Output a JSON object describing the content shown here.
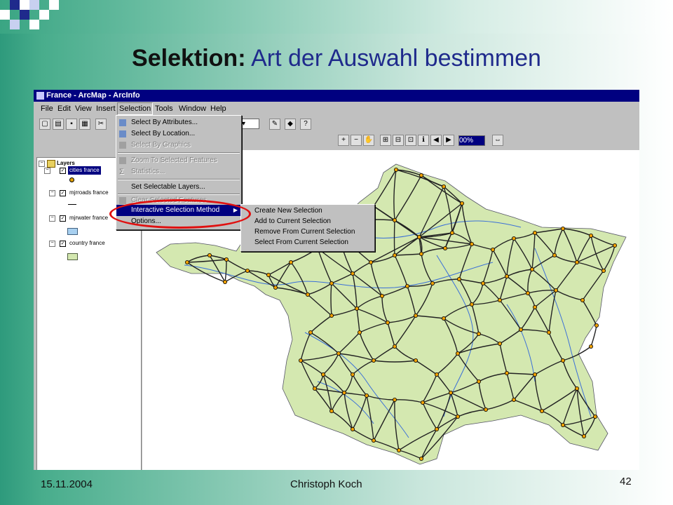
{
  "slide": {
    "title_bold": "Selektion:",
    "title_rest": "Art der Auswahl bestimmen",
    "footer_date": "15.11.2004",
    "footer_author": "Christoph Koch",
    "footer_page": "42"
  },
  "window": {
    "title": "France - ArcMap - ArcInfo",
    "menubar": [
      "File",
      "Edit",
      "View",
      "Insert",
      "Selection",
      "Tools",
      "Window",
      "Help"
    ],
    "active_menu": "Selection",
    "zoom_value": "00%"
  },
  "toc": {
    "root": "Layers",
    "layers": [
      {
        "name": "cities france",
        "selected": true,
        "symbol": "point"
      },
      {
        "name": "mjrroads france",
        "selected": false,
        "symbol": "line"
      },
      {
        "name": "mjrwater france",
        "selected": false,
        "symbol": "fill-blue"
      },
      {
        "name": "country france",
        "selected": false,
        "symbol": "fill-green"
      }
    ]
  },
  "selection_menu": {
    "items": [
      {
        "label": "Select By Attributes...",
        "disabled": false,
        "icon": "select-attributes-icon"
      },
      {
        "label": "Select By Location...",
        "disabled": false,
        "icon": "select-location-icon"
      },
      {
        "label": "Select By Graphics",
        "disabled": true,
        "icon": "select-graphics-icon"
      },
      {
        "label": "Zoom To Selected Features",
        "disabled": true,
        "icon": "zoom-selected-icon"
      },
      {
        "label": "Statistics...",
        "disabled": true,
        "icon": "statistics-icon"
      },
      {
        "label": "Set Selectable Layers...",
        "disabled": false,
        "icon": ""
      },
      {
        "label": "Clear Selected Features",
        "disabled": true,
        "icon": "clear-selection-icon"
      },
      {
        "label": "Interactive Selection Method",
        "disabled": false,
        "icon": "",
        "highlighted": true,
        "has_submenu": true
      },
      {
        "label": "Options...",
        "disabled": false,
        "icon": ""
      }
    ]
  },
  "submenu": {
    "items": [
      {
        "label": "Create New Selection"
      },
      {
        "label": "Add to Current Selection"
      },
      {
        "label": "Remove From Current Selection"
      },
      {
        "label": "Select From Current Selection"
      }
    ]
  },
  "colors": {
    "highlight": "#000080",
    "ellipse": "#e01010",
    "land": "#d4e8b0",
    "roads": "#222222",
    "rivers": "#3a6fd8",
    "cities": "#f0a000"
  }
}
